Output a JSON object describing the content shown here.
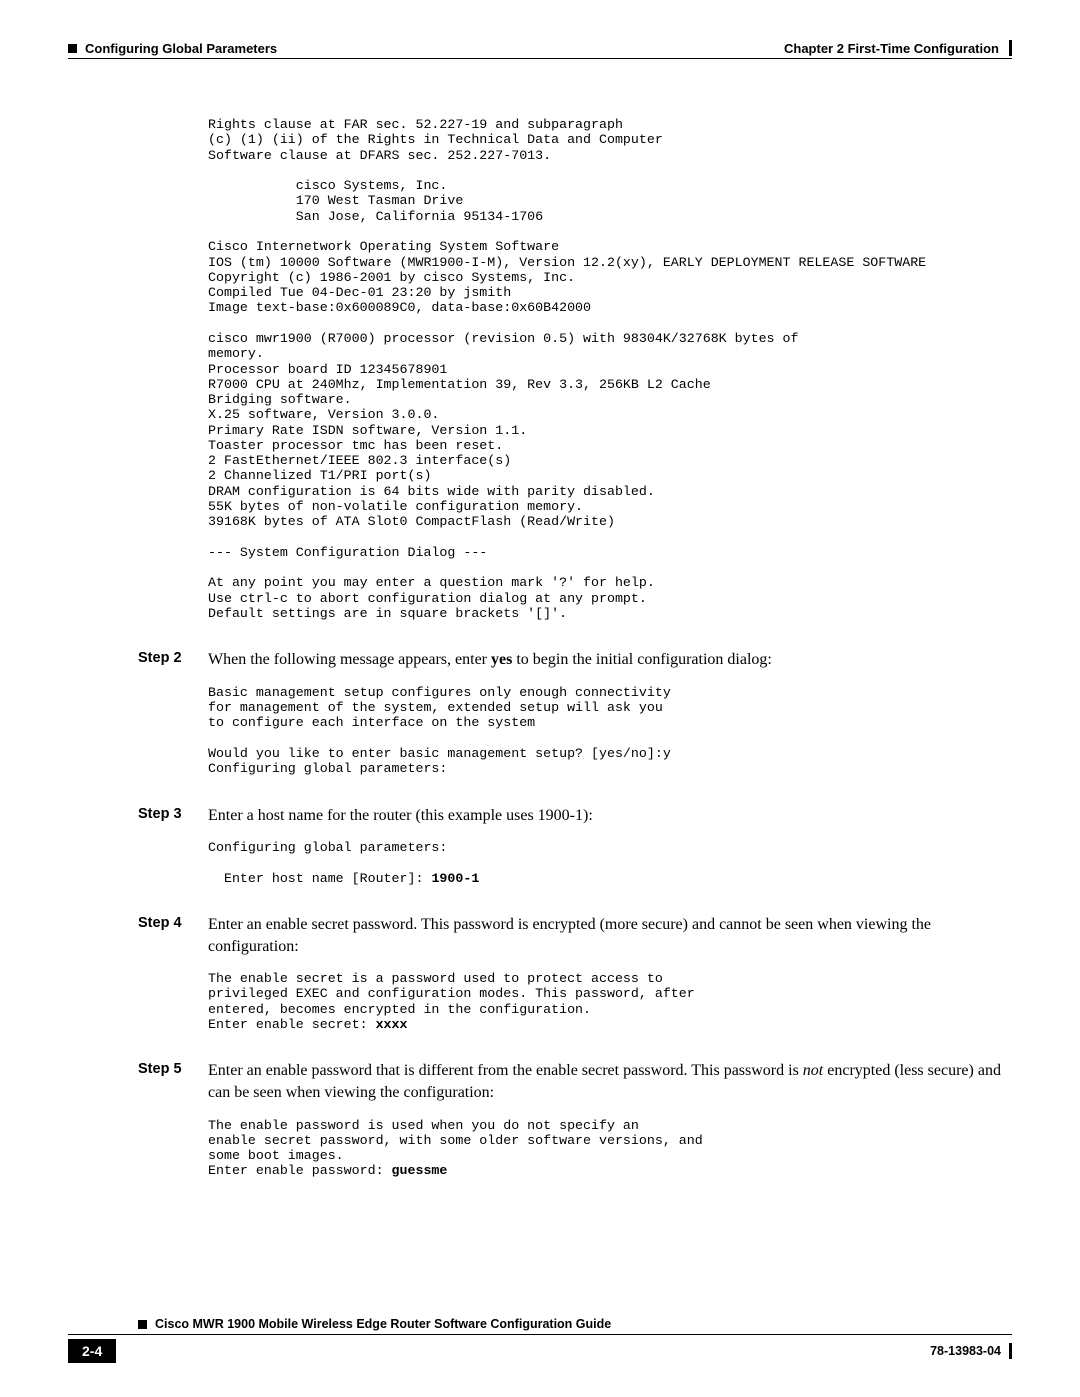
{
  "header": {
    "section": "Configuring Global Parameters",
    "chapter": "Chapter 2      First-Time Configuration"
  },
  "terminal_block_1": "Rights clause at FAR sec. 52.227-19 and subparagraph\n(c) (1) (ii) of the Rights in Technical Data and Computer\nSoftware clause at DFARS sec. 252.227-7013.\n\n           cisco Systems, Inc.\n           170 West Tasman Drive\n           San Jose, California 95134-1706\n\nCisco Internetwork Operating System Software\nIOS (tm) 10000 Software (MWR1900-I-M), Version 12.2(xy), EARLY DEPLOYMENT RELEASE SOFTWARE\nCopyright (c) 1986-2001 by cisco Systems, Inc.\nCompiled Tue 04-Dec-01 23:20 by jsmith\nImage text-base:0x600089C0, data-base:0x60B42000\n\ncisco mwr1900 (R7000) processor (revision 0.5) with 98304K/32768K bytes of\nmemory.\nProcessor board ID 12345678901\nR7000 CPU at 240Mhz, Implementation 39, Rev 3.3, 256KB L2 Cache\nBridging software.\nX.25 software, Version 3.0.0.\nPrimary Rate ISDN software, Version 1.1.\nToaster processor tmc has been reset.\n2 FastEthernet/IEEE 802.3 interface(s)\n2 Channelized T1/PRI port(s)\nDRAM configuration is 64 bits wide with parity disabled.\n55K bytes of non-volatile configuration memory.\n39168K bytes of ATA Slot0 CompactFlash (Read/Write)\n\n--- System Configuration Dialog ---\n\nAt any point you may enter a question mark '?' for help.\nUse ctrl-c to abort configuration dialog at any prompt.\nDefault settings are in square brackets '[]'.",
  "step2": {
    "label": "Step 2",
    "pre": "When the following message appears, enter ",
    "bold": "yes",
    "post": " to begin the initial configuration dialog:",
    "code": "Basic management setup configures only enough connectivity\nfor management of the system, extended setup will ask you\nto configure each interface on the system\n\nWould you like to enter basic management setup? [yes/no]:y\nConfiguring global parameters:"
  },
  "step3": {
    "label": "Step 3",
    "text": "Enter a host name for the router (this example uses 1900-1):",
    "code_pre": "Configuring global parameters:\n\n  Enter host name [Router]: ",
    "code_bold": "1900-1"
  },
  "step4": {
    "label": "Step 4",
    "text": "Enter an enable secret password. This password is encrypted (more secure) and cannot be seen when viewing the configuration:",
    "code_pre": "The enable secret is a password used to protect access to\nprivileged EXEC and configuration modes. This password, after\nentered, becomes encrypted in the configuration.\nEnter enable secret: ",
    "code_bold": "xxxx"
  },
  "step5": {
    "label": "Step 5",
    "pre": "Enter an enable password that is different from the enable secret password. This password is ",
    "italic": "not",
    "post": " encrypted (less secure) and can be seen when viewing the configuration:",
    "code_pre": "The enable password is used when you do not specify an\nenable secret password, with some older software versions, and\nsome boot images.\nEnter enable password: ",
    "code_bold": "guessme"
  },
  "footer": {
    "title": "Cisco MWR 1900 Mobile Wireless Edge Router Software Configuration Guide",
    "page": "2-4",
    "docnum": "78-13983-04"
  }
}
